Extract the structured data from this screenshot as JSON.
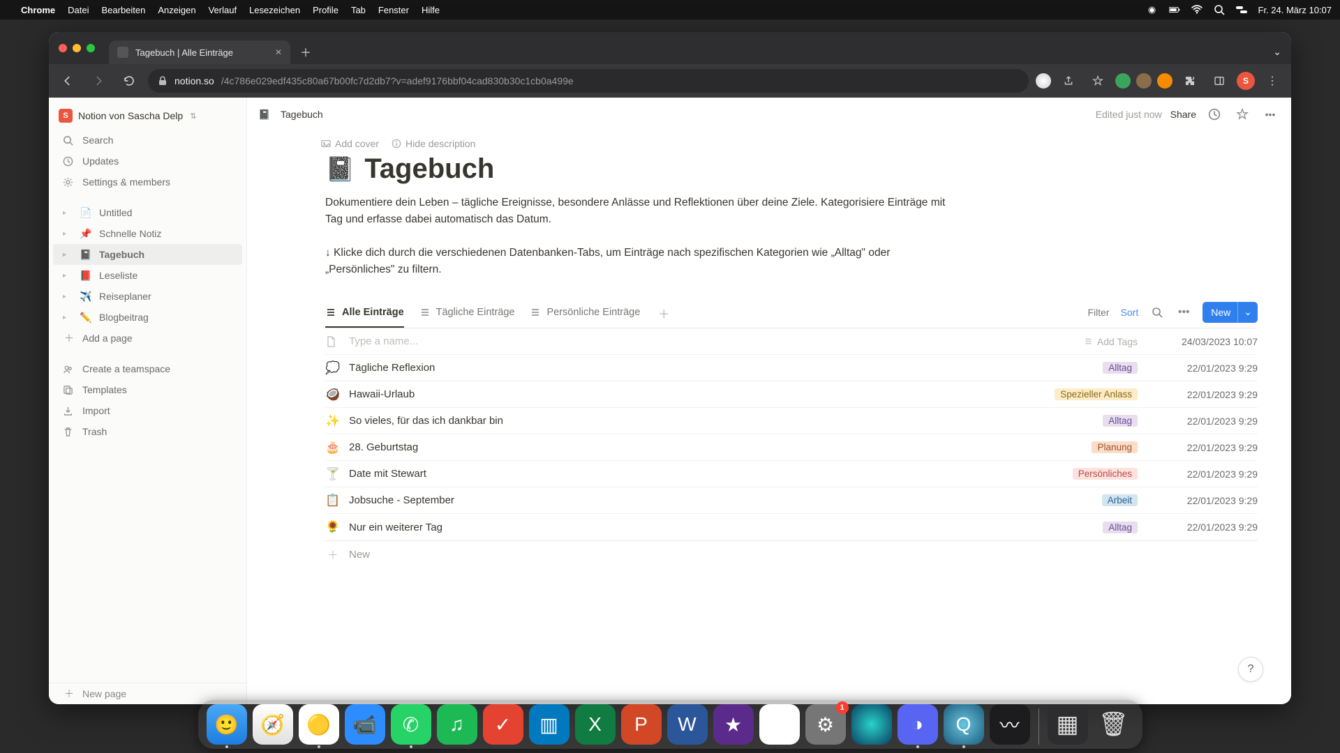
{
  "menubar": {
    "app": "Chrome",
    "items": [
      "Datei",
      "Bearbeiten",
      "Anzeigen",
      "Verlauf",
      "Lesezeichen",
      "Profile",
      "Tab",
      "Fenster",
      "Hilfe"
    ],
    "clock": "Fr. 24. März  10:07"
  },
  "chrome": {
    "tab_title": "Tagebuch | Alle Einträge",
    "url_host": "notion.so",
    "url_path": "/4c786e029edf435c80a67b00fc7d2db7?v=adef9176bbf04cad830b30c1cb0a499e",
    "avatar_letter": "S"
  },
  "notion": {
    "workspace": "Notion von Sascha Delp",
    "sidebar_top": [
      {
        "label": "Search",
        "icon": "search-icon"
      },
      {
        "label": "Updates",
        "icon": "clock-icon"
      },
      {
        "label": "Settings & members",
        "icon": "gear-icon"
      }
    ],
    "pages": [
      {
        "emoji": "📄",
        "label": "Untitled"
      },
      {
        "emoji": "📌",
        "label": "Schnelle Notiz"
      },
      {
        "emoji": "📓",
        "label": "Tagebuch"
      },
      {
        "emoji": "📕",
        "label": "Leseliste"
      },
      {
        "emoji": "✈️",
        "label": "Reiseplaner"
      },
      {
        "emoji": "✏️",
        "label": "Blogbeitrag"
      }
    ],
    "selected_page_index": 2,
    "add_page": "Add a page",
    "sidebar_bottom": [
      {
        "label": "Create a teamspace",
        "icon": "people-icon"
      },
      {
        "label": "Templates",
        "icon": "template-icon"
      },
      {
        "label": "Import",
        "icon": "import-icon"
      },
      {
        "label": "Trash",
        "icon": "trash-icon"
      }
    ],
    "new_page": "New page",
    "topbar": {
      "breadcrumb_emoji": "📓",
      "breadcrumb": "Tagebuch",
      "edited": "Edited just now",
      "share": "Share"
    },
    "page": {
      "add_cover": "Add cover",
      "hide_desc": "Hide description",
      "title_emoji": "📓",
      "title": "Tagebuch",
      "description": "Dokumentiere dein Leben – tägliche Ereignisse, besondere Anlässe und Reflektionen über deine Ziele. Kategorisiere Einträge mit Tag und erfasse dabei automatisch das Datum.",
      "hint": "↓ Klicke dich durch die verschiedenen Datenbanken-Tabs, um Einträge nach spezifischen Kategorien wie „Alltag\" oder „Persönliches\" zu filtern."
    },
    "db": {
      "views": [
        "Alle Einträge",
        "Tägliche Einträge",
        "Persönliche Einträge"
      ],
      "active_view": 0,
      "filter": "Filter",
      "sort": "Sort",
      "new": "New",
      "name_placeholder": "Type a name...",
      "add_tags": "Add Tags",
      "new_row": "New",
      "rows": [
        {
          "icon": "doc",
          "title": "",
          "tag": null,
          "tag_label": "",
          "date": "24/03/2023 10:07"
        },
        {
          "icon": "💭",
          "title": "Tägliche Reflexion",
          "tag": "alltag",
          "tag_label": "Alltag",
          "date": "22/01/2023 9:29"
        },
        {
          "icon": "🥥",
          "title": "Hawaii-Urlaub",
          "tag": "spezial",
          "tag_label": "Spezieller Anlass",
          "date": "22/01/2023 9:29"
        },
        {
          "icon": "✨",
          "title": "So vieles, für das ich dankbar bin",
          "tag": "alltag",
          "tag_label": "Alltag",
          "date": "22/01/2023 9:29"
        },
        {
          "icon": "🎂",
          "title": "28. Geburtstag",
          "tag": "planung",
          "tag_label": "Planung",
          "date": "22/01/2023 9:29"
        },
        {
          "icon": "🍸",
          "title": "Date mit Stewart",
          "tag": "pers",
          "tag_label": "Persönliches",
          "date": "22/01/2023 9:29"
        },
        {
          "icon": "📋",
          "title": "Jobsuche - September",
          "tag": "arbeit",
          "tag_label": "Arbeit",
          "date": "22/01/2023 9:29"
        },
        {
          "icon": "🌻",
          "title": "Nur ein weiterer Tag",
          "tag": "alltag",
          "tag_label": "Alltag",
          "date": "22/01/2023 9:29"
        }
      ]
    }
  },
  "dock": {
    "items": [
      {
        "name": "finder",
        "bg": "linear-gradient(#4aa8f7,#1d7de0)",
        "glyph": "🙂",
        "running": true
      },
      {
        "name": "safari",
        "bg": "linear-gradient(#fff,#e0e0e0)",
        "glyph": "🧭",
        "running": false
      },
      {
        "name": "chrome",
        "bg": "#fff",
        "glyph": "🟡",
        "running": true
      },
      {
        "name": "zoom",
        "bg": "#2d8cff",
        "glyph": "📹",
        "running": false
      },
      {
        "name": "whatsapp",
        "bg": "#25d366",
        "glyph": "✆",
        "running": true
      },
      {
        "name": "spotify",
        "bg": "#1db954",
        "glyph": "♫",
        "running": false
      },
      {
        "name": "todoist",
        "bg": "#e44332",
        "glyph": "✓",
        "running": false
      },
      {
        "name": "trello",
        "bg": "#0079bf",
        "glyph": "▥",
        "running": false
      },
      {
        "name": "excel",
        "bg": "#107c41",
        "glyph": "X",
        "running": false
      },
      {
        "name": "powerpoint",
        "bg": "#d24726",
        "glyph": "P",
        "running": false
      },
      {
        "name": "word",
        "bg": "#2b579a",
        "glyph": "W",
        "running": false
      },
      {
        "name": "imovie",
        "bg": "#5a2b8a",
        "glyph": "★",
        "running": false
      },
      {
        "name": "drive",
        "bg": "#fff",
        "glyph": "▲",
        "running": false
      },
      {
        "name": "settings",
        "bg": "#767676",
        "glyph": "⚙",
        "running": false,
        "badge": "1"
      },
      {
        "name": "siri",
        "bg": "radial-gradient(circle,#29d3c8,#0a3d62)",
        "glyph": "",
        "running": false
      },
      {
        "name": "discord",
        "bg": "#5865f2",
        "glyph": "◑",
        "running": true
      },
      {
        "name": "quicktime",
        "bg": "radial-gradient(circle,#6ac5e0,#1a5c7c)",
        "glyph": "Q",
        "running": true
      },
      {
        "name": "voice-memo",
        "bg": "#1c1c1e",
        "glyph": "〰",
        "running": false
      }
    ],
    "right": [
      {
        "name": "mission-control",
        "bg": "#2d2d2f",
        "glyph": "▦"
      },
      {
        "name": "trash",
        "bg": "transparent",
        "glyph": "🗑"
      }
    ]
  }
}
